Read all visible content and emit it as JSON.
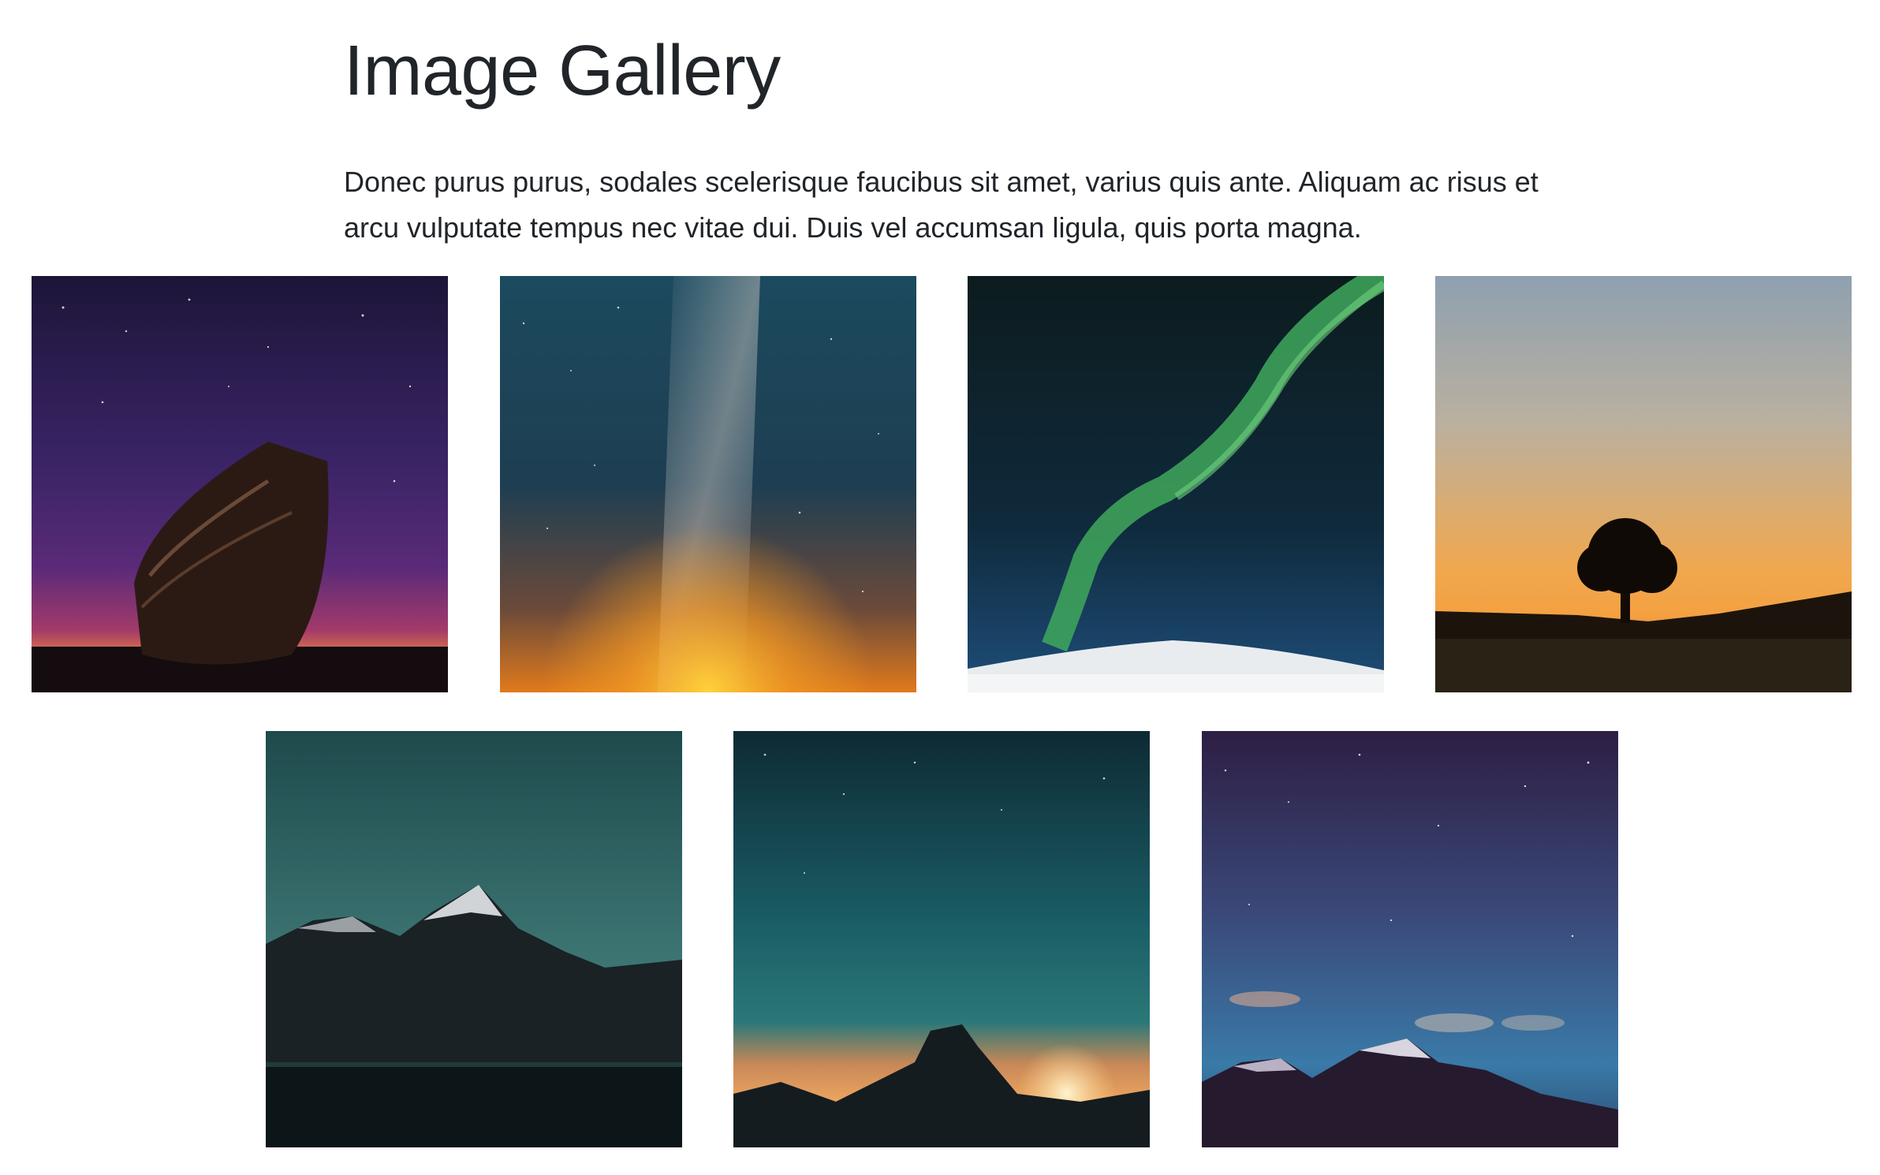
{
  "page": {
    "title": "Image Gallery",
    "intro": "Donec purus purus, sodales scelerisque faucibus sit amet, varius quis ante. Aliquam ac risus et arcu vulputate tempus nec vitae dui. Duis vel accumsan ligula, quis porta magna."
  },
  "gallery": {
    "images": [
      {
        "subject": "boat-under-starry-sky"
      },
      {
        "subject": "milky-way-with-sunrise-glow"
      },
      {
        "subject": "green-aurora-over-snow"
      },
      {
        "subject": "lone-tree-at-dusk"
      },
      {
        "subject": "mountains-at-night-teal"
      },
      {
        "subject": "half-dome-sunset-stars"
      },
      {
        "subject": "snowy-peaks-starry-purple-sky"
      }
    ]
  }
}
